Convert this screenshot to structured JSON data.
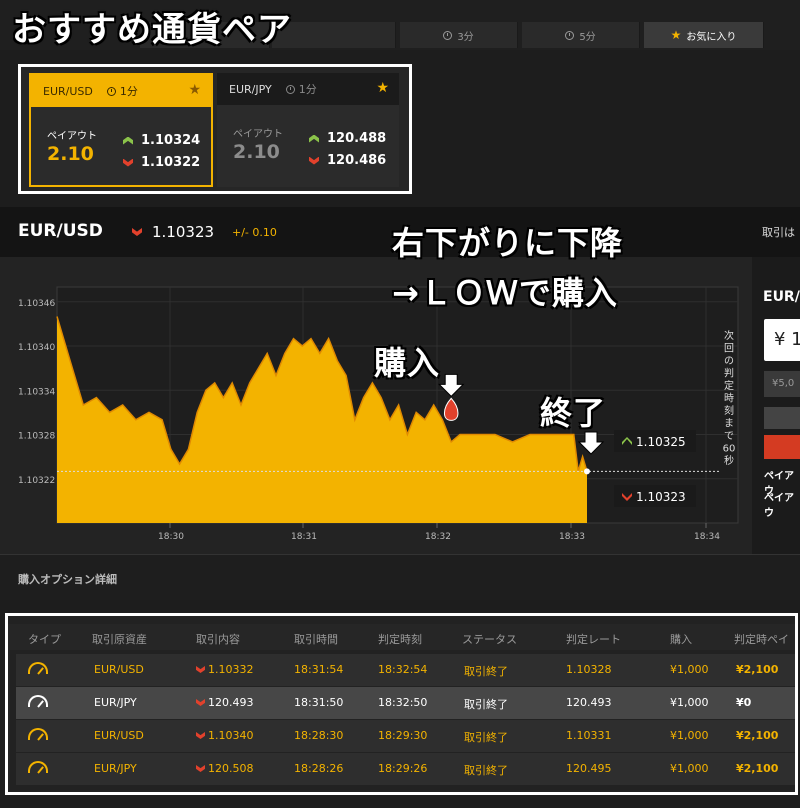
{
  "headline": "おすすめ通貨ペア",
  "tabs": [
    {
      "label": "",
      "active": false
    },
    {
      "label": "",
      "active": false
    },
    {
      "label": "3分",
      "active": false
    },
    {
      "label": "5分",
      "active": false
    },
    {
      "label": "お気に入り",
      "active": true
    }
  ],
  "favorites": [
    {
      "pair": "EUR/USD",
      "timeframe": "1分",
      "payout_label": "ペイアウト",
      "payout": "2.10",
      "high_rate": "1.10324",
      "low_rate": "1.10322",
      "selected": true
    },
    {
      "pair": "EUR/JPY",
      "timeframe": "1分",
      "payout_label": "ペイアウト",
      "payout": "2.10",
      "high_rate": "120.488",
      "low_rate": "120.486",
      "selected": false
    }
  ],
  "instrument": {
    "pair": "EUR/USD",
    "rate": "1.10323",
    "change": "+/- 0.10",
    "right_label": "取引は"
  },
  "annotations": {
    "trend_line1": "右下がりに下降",
    "trend_line2": "→ＬＯＷで購入",
    "buy": "購入",
    "end": "終了"
  },
  "chart_data": {
    "type": "area",
    "y_ticks": [
      "1.10346",
      "1.10340",
      "1.10334",
      "1.10328",
      "1.10322"
    ],
    "x_ticks": [
      "18:30",
      "18:31",
      "18:32",
      "18:33",
      "18:34"
    ],
    "ylim": [
      1.10316,
      1.10348
    ],
    "current_rate": 1.10323,
    "high_box": "1.10325",
    "low_box": "1.10323",
    "countdown": [
      "次",
      "回",
      "の",
      "判",
      "定",
      "時",
      "刻",
      "ま",
      "で",
      "60",
      "秒"
    ],
    "color": "#f3b300",
    "series": [
      {
        "values": [
          [
            0,
            1.10344
          ],
          [
            3,
            1.10338
          ],
          [
            6,
            1.10332
          ],
          [
            9,
            1.10333
          ],
          [
            12,
            1.10331
          ],
          [
            15,
            1.10332
          ],
          [
            18,
            1.1033
          ],
          [
            21,
            1.10331
          ],
          [
            24,
            1.1033
          ],
          [
            26,
            1.10326
          ],
          [
            28,
            1.10324
          ],
          [
            30,
            1.10326
          ],
          [
            32,
            1.10331
          ],
          [
            34,
            1.10334
          ],
          [
            36,
            1.10335
          ],
          [
            38,
            1.10333
          ],
          [
            40,
            1.10335
          ],
          [
            42,
            1.10332
          ],
          [
            44,
            1.10335
          ],
          [
            46,
            1.10337
          ],
          [
            48,
            1.10339
          ],
          [
            50,
            1.10336
          ],
          [
            52,
            1.10339
          ],
          [
            54,
            1.10341
          ],
          [
            56,
            1.1034
          ],
          [
            58,
            1.10341
          ],
          [
            60,
            1.10339
          ],
          [
            62,
            1.10341
          ],
          [
            64,
            1.10338
          ],
          [
            66,
            1.10336
          ],
          [
            68,
            1.1033
          ],
          [
            70,
            1.10333
          ],
          [
            72,
            1.10335
          ],
          [
            74,
            1.10333
          ],
          [
            76,
            1.1033
          ],
          [
            78,
            1.10332
          ],
          [
            80,
            1.10328
          ],
          [
            82,
            1.10331
          ],
          [
            84,
            1.1033
          ],
          [
            86,
            1.10332
          ],
          [
            88,
            1.1033
          ],
          [
            90,
            1.10327
          ],
          [
            92,
            1.10328
          ],
          [
            94,
            1.10328
          ],
          [
            100,
            1.10328
          ],
          [
            104,
            1.10327
          ],
          [
            108,
            1.10328
          ],
          [
            112,
            1.10328
          ],
          [
            116,
            1.10328
          ],
          [
            118,
            1.10328
          ],
          [
            119,
            1.10323
          ],
          [
            120,
            1.10325
          ],
          [
            121,
            1.10323
          ]
        ]
      }
    ],
    "buy_point": [
      90,
      1.10331
    ],
    "end_point": [
      121,
      1.10323
    ]
  },
  "section_title": "購入オプション詳細",
  "table": {
    "headers": [
      "タイプ",
      "取引原資産",
      "取引内容",
      "取引時間",
      "判定時刻",
      "ステータス",
      "判定レート",
      "購入",
      "判定時ペイ"
    ],
    "rows": [
      {
        "asset": "EUR/USD",
        "content": "1.10332",
        "time": "18:31:54",
        "judge_time": "18:32:54",
        "status": "取引終了",
        "judge_rate": "1.10328",
        "buy": "¥1,000",
        "payout": "¥2,100",
        "style": "yellow"
      },
      {
        "asset": "EUR/JPY",
        "content": "120.493",
        "time": "18:31:50",
        "judge_time": "18:32:50",
        "status": "取引終了",
        "judge_rate": "120.493",
        "buy": "¥1,000",
        "payout": "¥0",
        "style": "white"
      },
      {
        "asset": "EUR/USD",
        "content": "1.10340",
        "time": "18:28:30",
        "judge_time": "18:29:30",
        "status": "取引終了",
        "judge_rate": "1.10331",
        "buy": "¥1,000",
        "payout": "¥2,100",
        "style": "yellow"
      },
      {
        "asset": "EUR/JPY",
        "content": "120.508",
        "time": "18:28:26",
        "judge_time": "18:29:26",
        "status": "取引終了",
        "judge_rate": "120.495",
        "buy": "¥1,000",
        "payout": "¥2,100",
        "style": "yellow"
      }
    ]
  },
  "side_panel": {
    "title": "EUR/",
    "amount": "¥ 1",
    "amount2": "¥5,0",
    "payout_label1": "ペイアウ",
    "payout_label2": "ペイアウ"
  }
}
